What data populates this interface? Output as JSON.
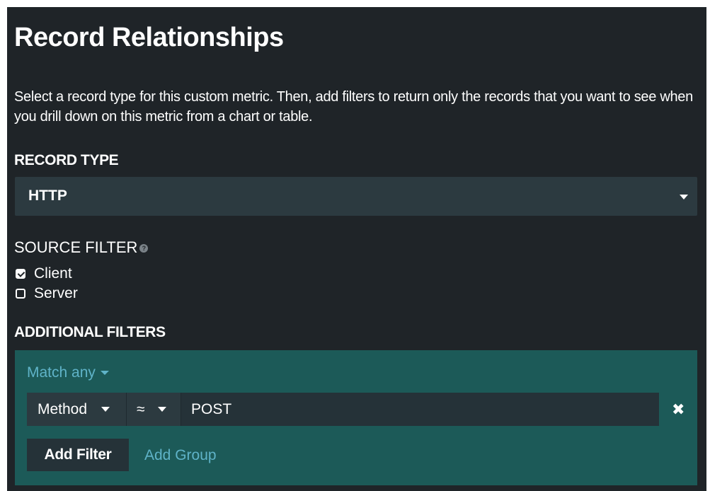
{
  "page": {
    "title": "Record Relationships",
    "description": "Select a record type for this custom metric. Then, add filters to return only the records that you want to see when you drill down on this metric from a chart or table."
  },
  "record_type": {
    "label": "RECORD TYPE",
    "selected": "HTTP"
  },
  "source_filter": {
    "label": "SOURCE FILTER",
    "help_icon": "help-icon",
    "options": [
      {
        "label": "Client",
        "checked": true
      },
      {
        "label": "Server",
        "checked": false
      }
    ]
  },
  "additional_filters": {
    "label": "ADDITIONAL FILTERS",
    "match_label": "Match any",
    "filters": [
      {
        "field": "Method",
        "operator": "≈",
        "value": "POST"
      }
    ],
    "remove_icon": "✖",
    "add_filter_label": "Add Filter",
    "add_group_label": "Add Group"
  },
  "colors": {
    "panel_bg": "#1f2428",
    "select_bg": "#2c3a40",
    "filters_bg": "#1c5a58",
    "link": "#5fb3c8"
  }
}
